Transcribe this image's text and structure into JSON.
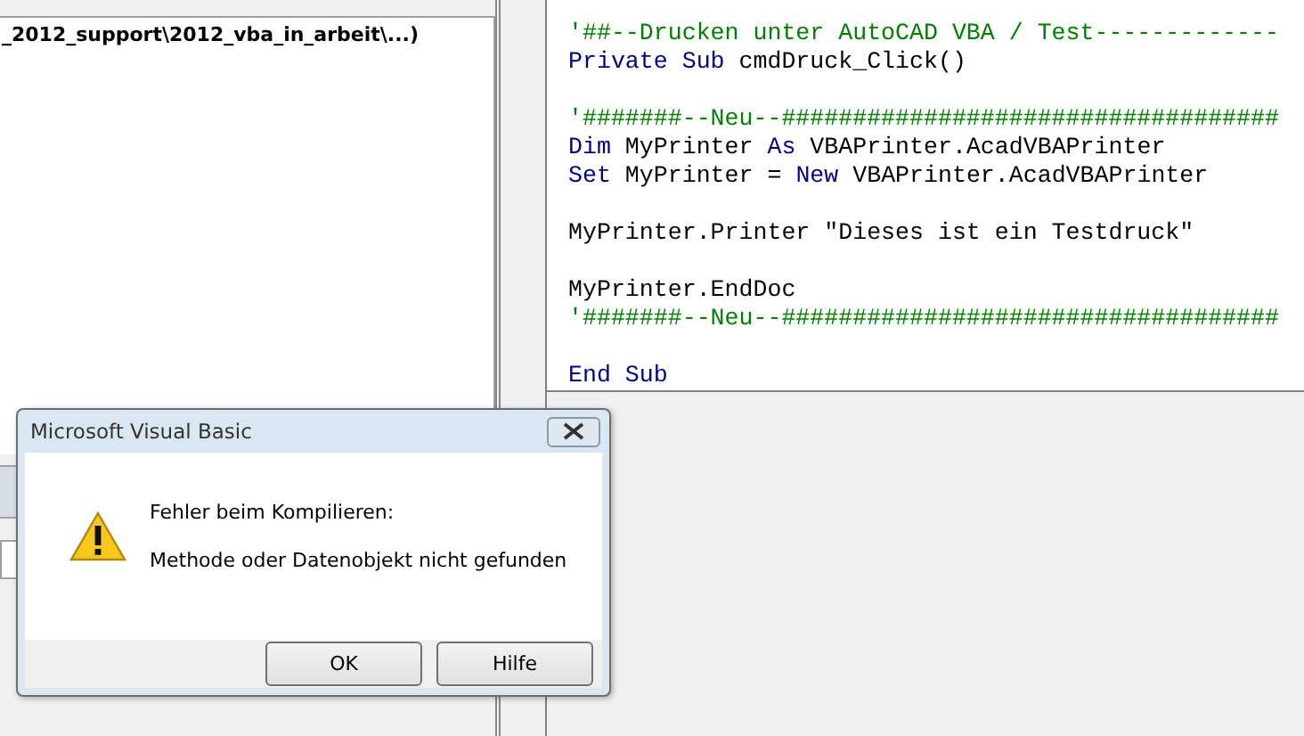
{
  "project_panel": {
    "title": "_2012_support\\2012_vba_in_arbeit\\...)"
  },
  "code_window": {
    "lines": [
      {
        "kind": "code",
        "tokens": [
          {
            "kind": "comment",
            "text": "'##--Drucken unter AutoCAD VBA / Test-------------"
          }
        ]
      },
      {
        "kind": "code",
        "tokens": [
          {
            "kind": "keyword",
            "text": "Private Sub"
          },
          {
            "kind": "plain",
            "text": " cmdDruck_Click()"
          }
        ]
      },
      {
        "kind": "blank"
      },
      {
        "kind": "code",
        "tokens": [
          {
            "kind": "comment",
            "text": "'#######--Neu--###################################"
          }
        ]
      },
      {
        "kind": "code",
        "tokens": [
          {
            "kind": "keyword",
            "text": "Dim"
          },
          {
            "kind": "plain",
            "text": " MyPrinter "
          },
          {
            "kind": "keyword",
            "text": "As"
          },
          {
            "kind": "plain",
            "text": " VBAPrinter.AcadVBAPrinter"
          }
        ]
      },
      {
        "kind": "code",
        "tokens": [
          {
            "kind": "keyword",
            "text": "Set"
          },
          {
            "kind": "plain",
            "text": " MyPrinter = "
          },
          {
            "kind": "keyword",
            "text": "New"
          },
          {
            "kind": "plain",
            "text": " VBAPrinter.AcadVBAPrinter"
          }
        ]
      },
      {
        "kind": "blank"
      },
      {
        "kind": "code",
        "tokens": [
          {
            "kind": "plain",
            "text": "MyPrinter.Printer \"Dieses ist ein Testdruck\""
          }
        ]
      },
      {
        "kind": "blank"
      },
      {
        "kind": "code",
        "tokens": [
          {
            "kind": "plain",
            "text": "MyPrinter.EndDoc"
          }
        ]
      },
      {
        "kind": "code",
        "tokens": [
          {
            "kind": "comment",
            "text": "'#######--Neu--###################################"
          }
        ]
      },
      {
        "kind": "blank"
      },
      {
        "kind": "code",
        "tokens": [
          {
            "kind": "keyword",
            "text": "End Sub"
          }
        ]
      }
    ]
  },
  "dialog": {
    "title": "Microsoft Visual Basic",
    "messages": [
      "Fehler beim Kompilieren:",
      "Methode oder Datenobjekt nicht gefunden"
    ],
    "buttons": [
      "OK",
      "Hilfe"
    ]
  }
}
